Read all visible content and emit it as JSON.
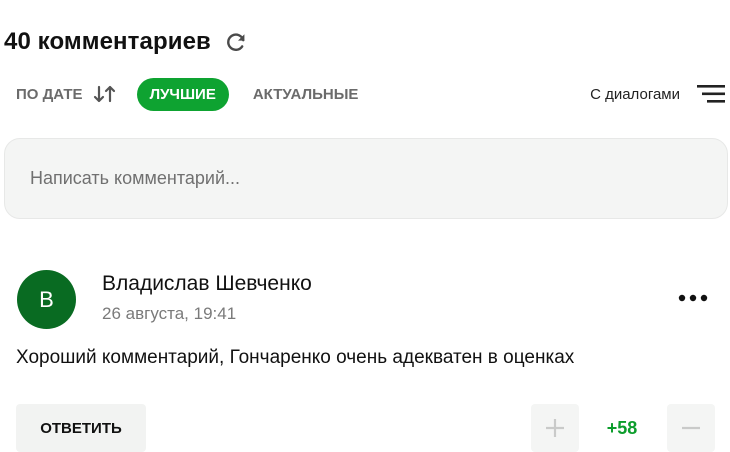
{
  "header": {
    "title": "40 комментариев",
    "refresh_icon": "refresh-icon"
  },
  "sort": {
    "by_date": "ПО ДАТЕ",
    "sort_icon": "sort-arrows-icon",
    "best": "ЛУЧШИЕ",
    "actual": "АКТУАЛЬНЫЕ",
    "active": "best",
    "dialogs_label": "С диалогами",
    "menu_icon": "menu-lines-icon"
  },
  "composer": {
    "placeholder": "Написать комментарий..."
  },
  "comment": {
    "avatar_letter": "В",
    "author": "Владислав Шевченко",
    "date": "26 августа, 19:41",
    "text": "Хороший комментарий, Гончаренко очень адекватен в оценках",
    "reply_label": "ОТВЕТИТЬ",
    "score": "+58",
    "more_icon": "more-dots-icon"
  },
  "colors": {
    "accent_green": "#0ea331",
    "avatar_green": "#096b22",
    "score_green": "#0c9d2c"
  }
}
